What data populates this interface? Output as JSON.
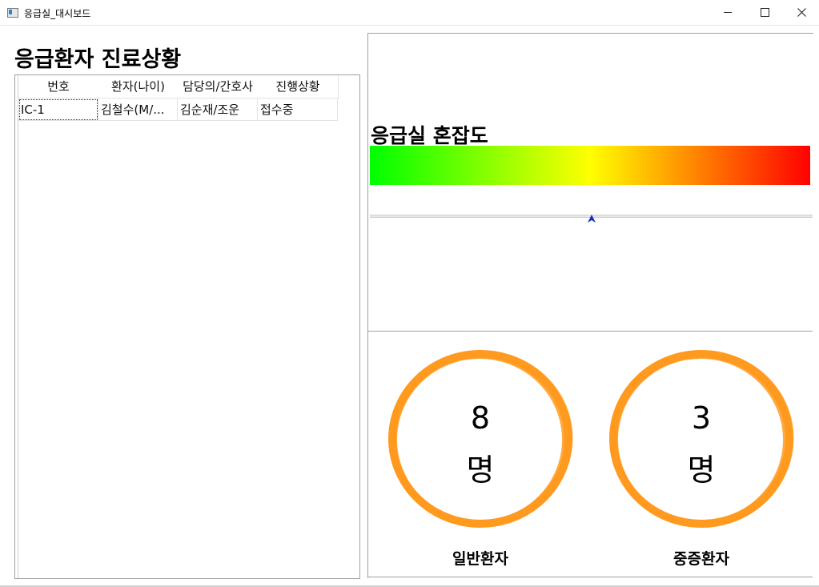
{
  "window": {
    "title": "응급실_대시보드"
  },
  "patients": {
    "title": "응급환자 진료상황",
    "columns": [
      "번호",
      "환자(나이)",
      "담당의/간호사",
      "진행상황"
    ],
    "rows": [
      [
        "IC-1",
        "김철수(M/...",
        "김순재/조운",
        "접수중"
      ]
    ]
  },
  "congestion": {
    "title": "응급실 혼잡도",
    "level_fraction": 0.5,
    "gradient_colors": [
      "#00ff00",
      "#ffff00",
      "#ff0000"
    ],
    "thumb_color": "#1a2fbf"
  },
  "counts": {
    "general": {
      "value": "8",
      "unit": "명",
      "label": "일반환자"
    },
    "critical": {
      "value": "3",
      "unit": "명",
      "label": "중증환자"
    },
    "ring_color": "#ff9a1f"
  }
}
